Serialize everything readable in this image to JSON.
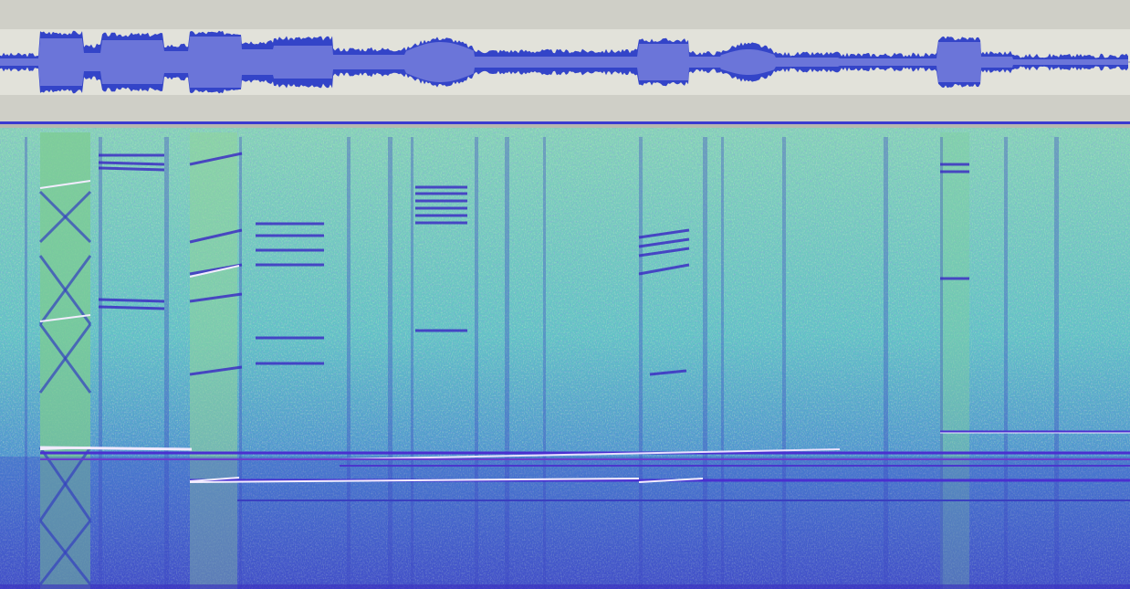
{
  "colors": {
    "track_bg": "#cfcfc7",
    "wave_band": "#e2e2da",
    "waveform": "#3344c8",
    "waveform_rms": "#6b75d9",
    "selection_line": "#3a3ad0",
    "spectro_base": "#5fb7c8",
    "spectro_low": "#3b4fcf",
    "spectro_high": "#e8f0f0",
    "spectro_green": "#8ad48c"
  },
  "tracks": [
    {
      "kind": "waveform",
      "icon": "waveform-icon"
    },
    {
      "kind": "spectrogram",
      "icon": "spectrogram-icon"
    }
  ]
}
